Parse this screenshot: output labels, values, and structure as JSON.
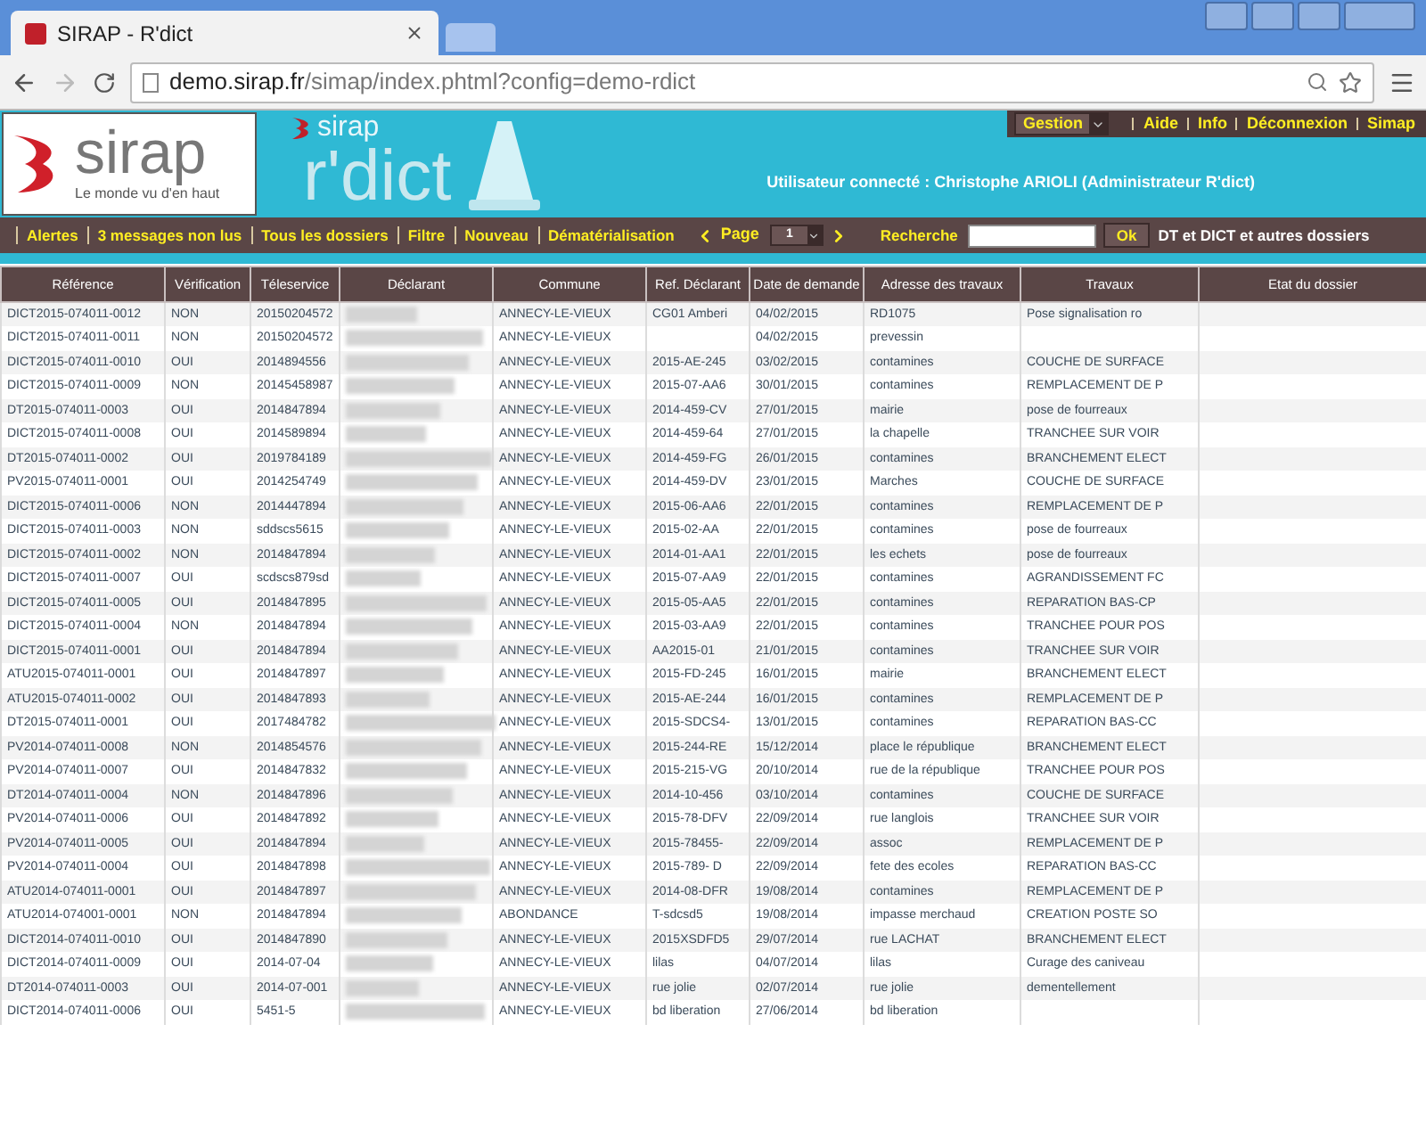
{
  "browser": {
    "tab_title": "SIRAP - R'dict",
    "url_host": "demo.sirap.fr",
    "url_path": "/simap/index.phtml?config=demo-rdict"
  },
  "header": {
    "logo_name": "sirap",
    "logo_tagline": "Le monde vu d'en haut",
    "app_brand": "sirap",
    "app_name": "r'dict",
    "menu": [
      {
        "label": "Gestion",
        "kind": "dropdown"
      },
      {
        "label": "Aide",
        "kind": "link"
      },
      {
        "label": "Info",
        "kind": "link"
      },
      {
        "label": "Déconnexion",
        "kind": "link"
      },
      {
        "label": "Simap",
        "kind": "link"
      }
    ],
    "user": "Utilisateur connecté : Christophe ARIOLI (Administrateur R'dict)"
  },
  "nav": {
    "links": [
      "Alertes",
      "3 messages non lus",
      "Tous les dossiers",
      "Filtre",
      "Nouveau",
      "Dématérialisation"
    ],
    "page_label": "Page",
    "page_value": "1",
    "search_label": "Recherche",
    "search_button": "Ok",
    "scope": "DT et DICT et autres dossiers"
  },
  "table": {
    "columns": [
      "Référence",
      "Vérification",
      "Téleservice",
      "Déclarant",
      "Commune",
      "Ref. Déclarant",
      "Date de demande",
      "Adresse des travaux",
      "Travaux",
      "Etat du dossier"
    ],
    "rows": [
      {
        "reference": "DICT2015-074011-0012",
        "verification": "NON",
        "teleservice": "20150204572",
        "commune": "ANNECY-LE-VIEUX",
        "ref_declarant": "CG01 Amberi",
        "date": "04/02/2015",
        "adresse": "RD1075",
        "travaux": "Pose signalisation ro"
      },
      {
        "reference": "DICT2015-074011-0011",
        "verification": "NON",
        "teleservice": "20150204572",
        "commune": "ANNECY-LE-VIEUX",
        "date": "04/02/2015",
        "adresse": "prevessin"
      },
      {
        "reference": "DICT2015-074011-0010",
        "verification": "OUI",
        "teleservice": "2014894556",
        "commune": "ANNECY-LE-VIEUX",
        "ref_declarant": "2015-AE-245",
        "date": "03/02/2015",
        "adresse": "contamines",
        "travaux": "COUCHE DE SURFACE"
      },
      {
        "reference": "DICT2015-074011-0009",
        "verification": "NON",
        "teleservice": "20145458987",
        "commune": "ANNECY-LE-VIEUX",
        "ref_declarant": "2015-07-AA6",
        "date": "30/01/2015",
        "adresse": "contamines",
        "travaux": "REMPLACEMENT DE P"
      },
      {
        "reference": "DT2015-074011-0003",
        "verification": "OUI",
        "teleservice": "2014847894",
        "commune": "ANNECY-LE-VIEUX",
        "ref_declarant": "2014-459-CV",
        "date": "27/01/2015",
        "adresse": "mairie",
        "travaux": "pose de fourreaux"
      },
      {
        "reference": "DICT2015-074011-0008",
        "verification": "OUI",
        "teleservice": "2014589894",
        "commune": "ANNECY-LE-VIEUX",
        "ref_declarant": "2014-459-64",
        "date": "27/01/2015",
        "adresse": "la chapelle",
        "travaux": "TRANCHEE SUR VOIR"
      },
      {
        "reference": "DT2015-074011-0002",
        "verification": "OUI",
        "teleservice": "2019784189",
        "commune": "ANNECY-LE-VIEUX",
        "ref_declarant": "2014-459-FG",
        "date": "26/01/2015",
        "adresse": "contamines",
        "travaux": "BRANCHEMENT ELECT"
      },
      {
        "reference": "PV2015-074011-0001",
        "verification": "OUI",
        "teleservice": "2014254749",
        "commune": "ANNECY-LE-VIEUX",
        "ref_declarant": "2014-459-DV",
        "date": "23/01/2015",
        "adresse": "Marches",
        "travaux": "COUCHE DE SURFACE"
      },
      {
        "reference": "DICT2015-074011-0006",
        "verification": "NON",
        "teleservice": "2014447894",
        "commune": "ANNECY-LE-VIEUX",
        "ref_declarant": "2015-06-AA6",
        "date": "22/01/2015",
        "adresse": "contamines",
        "travaux": "REMPLACEMENT DE P"
      },
      {
        "reference": "DICT2015-074011-0003",
        "verification": "NON",
        "teleservice": "sddscs5615",
        "commune": "ANNECY-LE-VIEUX",
        "ref_declarant": "2015-02-AA",
        "date": "22/01/2015",
        "adresse": "contamines",
        "travaux": "pose de fourreaux"
      },
      {
        "reference": "DICT2015-074011-0002",
        "verification": "NON",
        "teleservice": "2014847894",
        "commune": "ANNECY-LE-VIEUX",
        "ref_declarant": "2014-01-AA1",
        "date": "22/01/2015",
        "adresse": "les echets",
        "travaux": "pose de fourreaux"
      },
      {
        "reference": "DICT2015-074011-0007",
        "verification": "OUI",
        "teleservice": "scdscs879sd",
        "commune": "ANNECY-LE-VIEUX",
        "ref_declarant": "2015-07-AA9",
        "date": "22/01/2015",
        "adresse": "contamines",
        "travaux": "AGRANDISSEMENT FC"
      },
      {
        "reference": "DICT2015-074011-0005",
        "verification": "OUI",
        "teleservice": "2014847895",
        "commune": "ANNECY-LE-VIEUX",
        "ref_declarant": "2015-05-AA5",
        "date": "22/01/2015",
        "adresse": "contamines",
        "travaux": "REPARATION BAS-CP"
      },
      {
        "reference": "DICT2015-074011-0004",
        "verification": "NON",
        "teleservice": "2014847894",
        "commune": "ANNECY-LE-VIEUX",
        "ref_declarant": "2015-03-AA9",
        "date": "22/01/2015",
        "adresse": "contamines",
        "travaux": "TRANCHEE POUR POS"
      },
      {
        "reference": "DICT2015-074011-0001",
        "verification": "OUI",
        "teleservice": "2014847894",
        "commune": "ANNECY-LE-VIEUX",
        "ref_declarant": "AA2015-01",
        "date": "21/01/2015",
        "adresse": "contamines",
        "travaux": "TRANCHEE SUR VOIR"
      },
      {
        "reference": "ATU2015-074011-0001",
        "verification": "OUI",
        "teleservice": "2014847897",
        "commune": "ANNECY-LE-VIEUX",
        "ref_declarant": "2015-FD-245",
        "date": "16/01/2015",
        "adresse": "mairie",
        "travaux": "BRANCHEMENT ELECT"
      },
      {
        "reference": "ATU2015-074011-0002",
        "verification": "OUI",
        "teleservice": "2014847893",
        "commune": "ANNECY-LE-VIEUX",
        "ref_declarant": "2015-AE-244",
        "date": "16/01/2015",
        "adresse": "contamines",
        "travaux": "REMPLACEMENT DE P"
      },
      {
        "reference": "DT2015-074011-0001",
        "verification": "OUI",
        "teleservice": "2017484782",
        "commune": "ANNECY-LE-VIEUX",
        "ref_declarant": "2015-SDCS4-",
        "date": "13/01/2015",
        "adresse": "contamines",
        "travaux": "REPARATION BAS-CC"
      },
      {
        "reference": "PV2014-074011-0008",
        "verification": "NON",
        "teleservice": "2014854576",
        "commune": "ANNECY-LE-VIEUX",
        "ref_declarant": "2015-244-RE",
        "date": "15/12/2014",
        "adresse": "place le république",
        "travaux": "BRANCHEMENT ELECT"
      },
      {
        "reference": "PV2014-074011-0007",
        "verification": "OUI",
        "teleservice": "2014847832",
        "commune": "ANNECY-LE-VIEUX",
        "ref_declarant": "2015-215-VG",
        "date": "20/10/2014",
        "adresse": "rue de la république",
        "travaux": "TRANCHEE POUR POS"
      },
      {
        "reference": "DT2014-074011-0004",
        "verification": "NON",
        "teleservice": "2014847896",
        "commune": "ANNECY-LE-VIEUX",
        "ref_declarant": "2014-10-456",
        "date": "03/10/2014",
        "adresse": "contamines",
        "travaux": "COUCHE DE SURFACE"
      },
      {
        "reference": "PV2014-074011-0006",
        "verification": "OUI",
        "teleservice": "2014847892",
        "commune": "ANNECY-LE-VIEUX",
        "ref_declarant": "2015-78-DFV",
        "date": "22/09/2014",
        "adresse": "rue langlois",
        "travaux": "TRANCHEE SUR VOIR"
      },
      {
        "reference": "PV2014-074011-0005",
        "verification": "OUI",
        "teleservice": "2014847894",
        "commune": "ANNECY-LE-VIEUX",
        "ref_declarant": "2015-78455-",
        "date": "22/09/2014",
        "adresse": "assoc",
        "travaux": "REMPLACEMENT DE P"
      },
      {
        "reference": "PV2014-074011-0004",
        "verification": "OUI",
        "teleservice": "2014847898",
        "commune": "ANNECY-LE-VIEUX",
        "ref_declarant": "2015-789- D",
        "date": "22/09/2014",
        "adresse": "fete des ecoles",
        "travaux": "REPARATION BAS-CC"
      },
      {
        "reference": "ATU2014-074011-0001",
        "verification": "OUI",
        "teleservice": "2014847897",
        "commune": "ANNECY-LE-VIEUX",
        "ref_declarant": "2014-08-DFR",
        "date": "19/08/2014",
        "adresse": "contamines",
        "travaux": "REMPLACEMENT DE P"
      },
      {
        "reference": "ATU2014-074001-0001",
        "verification": "NON",
        "teleservice": "2014847894",
        "commune": "ABONDANCE",
        "ref_declarant": "T-sdcsd5",
        "date": "19/08/2014",
        "adresse": "impasse merchaud",
        "travaux": "CREATION POSTE SO"
      },
      {
        "reference": "DICT2014-074011-0010",
        "verification": "OUI",
        "teleservice": "2014847890",
        "commune": "ANNECY-LE-VIEUX",
        "ref_declarant": "2015XSDFD5",
        "date": "29/07/2014",
        "adresse": "rue LACHAT",
        "travaux": "BRANCHEMENT ELECT"
      },
      {
        "reference": "DICT2014-074011-0009",
        "verification": "OUI",
        "teleservice": "2014-07-04",
        "commune": "ANNECY-LE-VIEUX",
        "ref_declarant": "lilas",
        "date": "04/07/2014",
        "adresse": "lilas",
        "travaux": "Curage des caniveau"
      },
      {
        "reference": "DT2014-074011-0003",
        "verification": "OUI",
        "teleservice": "2014-07-001",
        "commune": "ANNECY-LE-VIEUX",
        "ref_declarant": "rue jolie",
        "date": "02/07/2014",
        "adresse": "rue jolie",
        "travaux": "dementellement"
      },
      {
        "reference": "DICT2014-074011-0006",
        "verification": "OUI",
        "teleservice": "5451-5",
        "commune": "ANNECY-LE-VIEUX",
        "ref_declarant": "bd liberation",
        "date": "27/06/2014",
        "adresse": "bd liberation"
      }
    ]
  }
}
